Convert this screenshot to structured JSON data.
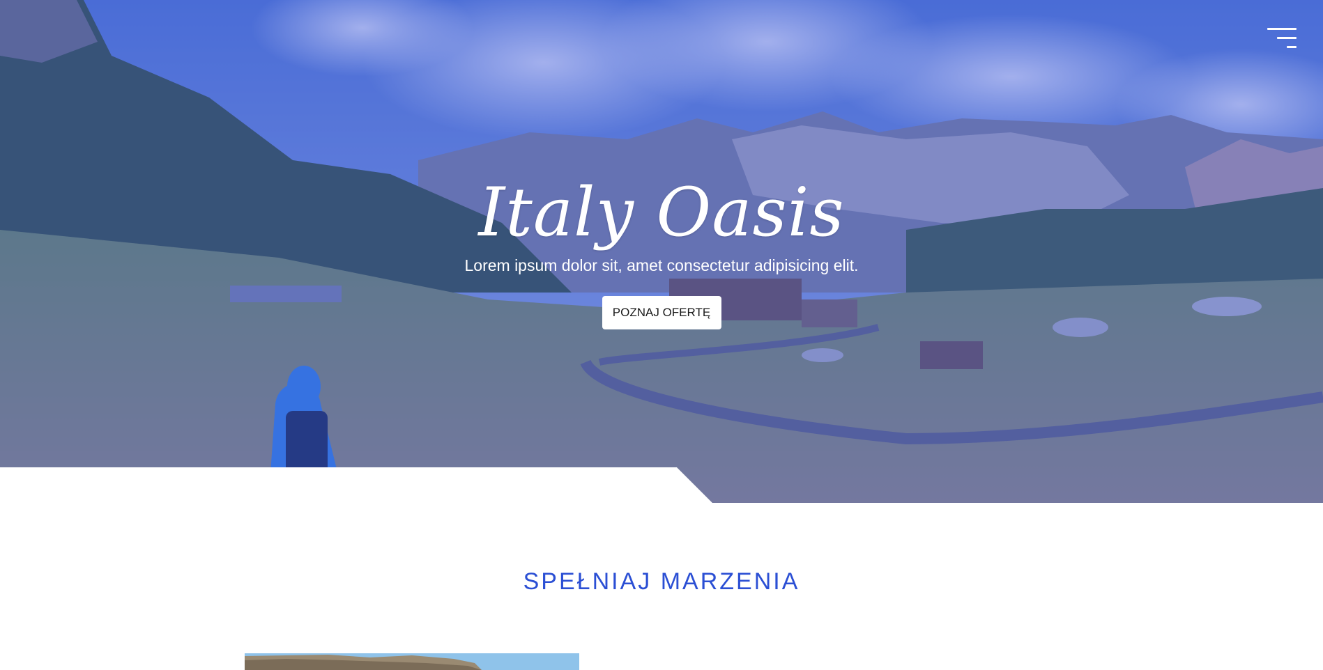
{
  "hero": {
    "title": "Italy Oasis",
    "subtitle": "Lorem ipsum dolor sit, amet consectetur adipisicing elit.",
    "cta_label": "POZNAJ OFERTĘ",
    "background": "mountain-valley-photo",
    "overlay_color": "#2d4bd7"
  },
  "nav": {
    "menu_icon": "hamburger-icon"
  },
  "section": {
    "title": "SPEŁNIAJ MARZENIA",
    "title_color": "#2b4fd4",
    "image": "ancient-ruins-photo"
  }
}
